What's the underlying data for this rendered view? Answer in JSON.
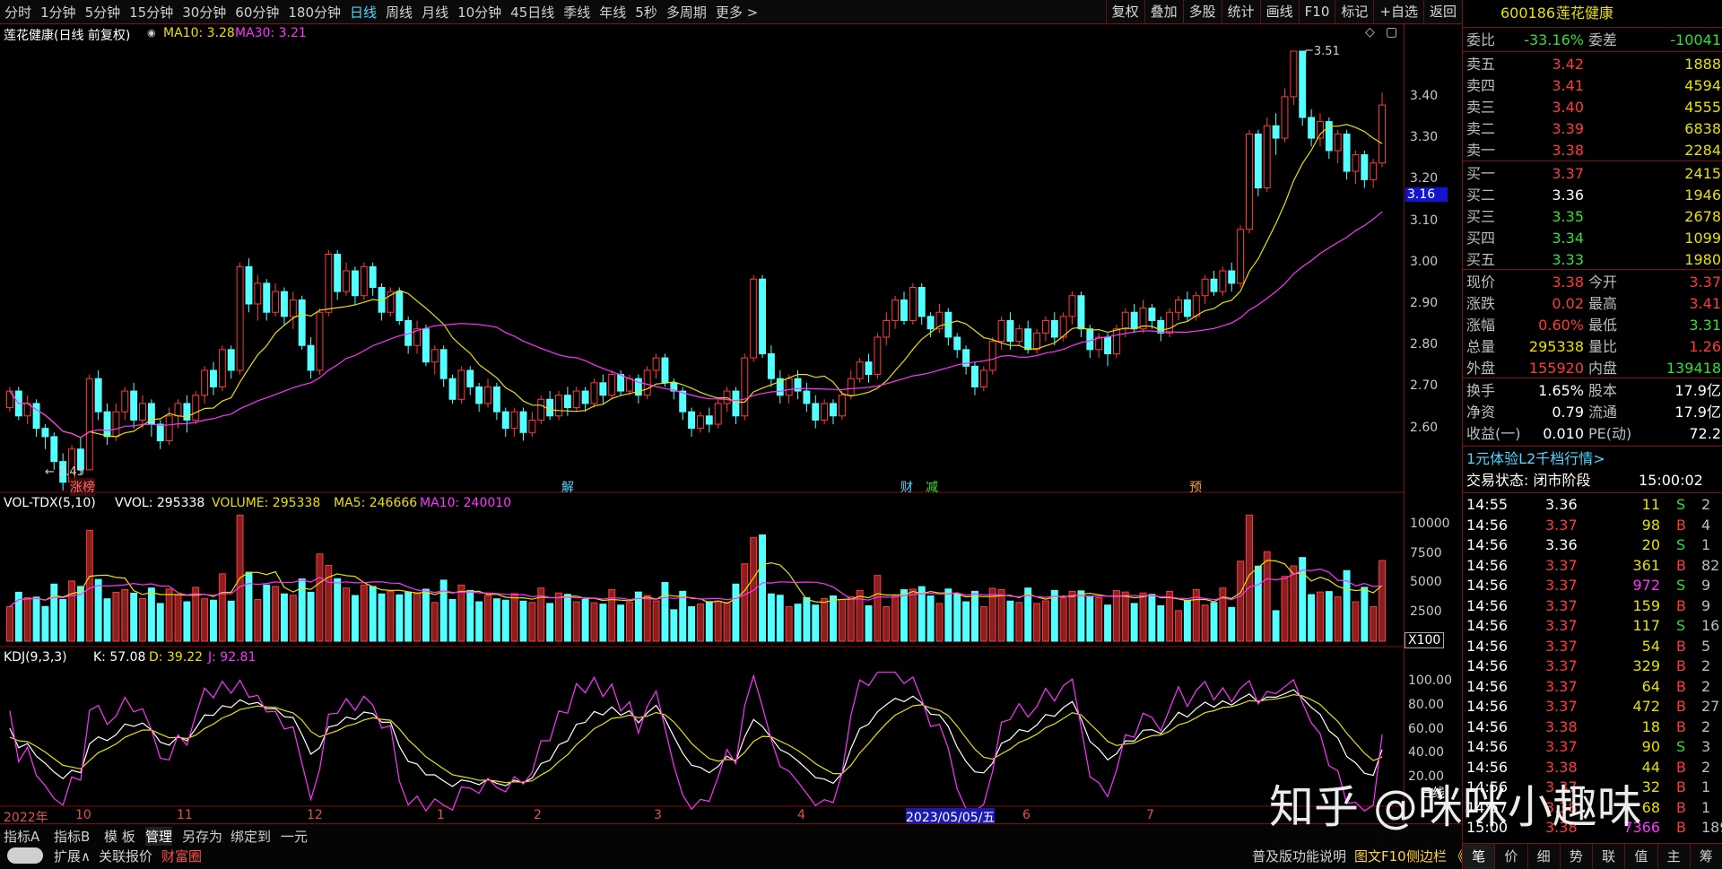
{
  "timeframes": [
    "分时",
    "1分钟",
    "5分钟",
    "15分钟",
    "30分钟",
    "60分钟",
    "180分钟",
    "日线",
    "周线",
    "月线",
    "10分钟",
    "45日线",
    "季线",
    "年线",
    "5秒",
    "多周期",
    "更多 >"
  ],
  "active_timeframe": "日线",
  "toolbar": [
    "复权",
    "叠加",
    "多股",
    "统计",
    "画线",
    "F10",
    "标记",
    "+自选",
    "返回"
  ],
  "chart_title": "莲花健康(日线 前复权)",
  "ma_legend": {
    "ma10": "MA10: 3.28",
    "ma30": "MA30: 3.21"
  },
  "vol_legend": {
    "name": "VOL-TDX(5,10)",
    "vvol": "VVOL: 295338",
    "volume": "VOLUME: 295338",
    "ma5": "MA5: 246666",
    "ma10": "MA10: 240010"
  },
  "kdj_legend": {
    "name": "KDJ(9,3,3)",
    "k": "K: 57.08",
    "d": "D: 39.22",
    "j": "J: 92.81"
  },
  "annotations": {
    "high": "3.51",
    "low": "2.45",
    "current_price_tag": "3.16",
    "x100": "X100"
  },
  "markers": [
    "涨榜",
    "解",
    "财",
    "减",
    "预"
  ],
  "price_axis": [
    "3.40",
    "3.30",
    "3.20",
    "3.10",
    "3.00",
    "2.90",
    "2.80",
    "2.70",
    "2.60"
  ],
  "vol_axis": [
    "10000",
    "7500",
    "5000",
    "2500"
  ],
  "kdj_axis": [
    "100.00",
    "80.00",
    "60.00",
    "40.00",
    "20.00"
  ],
  "date_axis": [
    "2022年",
    "10",
    "11",
    "12",
    "1",
    "2",
    "3",
    "4",
    "2023/05/05/五",
    "6",
    "7",
    "日线"
  ],
  "bottom_tabs": [
    "指标A",
    "指标B",
    "模 板",
    "管理",
    "另存为",
    "绑定到",
    "一元"
  ],
  "bottom_row2": [
    "扩展∧",
    "关联报价",
    "财富圈"
  ],
  "bottom_right": [
    "普及版功能说明",
    "图文F10",
    "侧边栏 《"
  ],
  "stock": {
    "code": "600186",
    "name": "莲花健康"
  },
  "weibi": {
    "label": "委比",
    "value": "-33.16%",
    "wc_label": "委差",
    "wc_value": "-10041"
  },
  "asks": [
    {
      "label": "卖五",
      "price": "3.42",
      "vol": "1888"
    },
    {
      "label": "卖四",
      "price": "3.41",
      "vol": "4594"
    },
    {
      "label": "卖三",
      "price": "3.40",
      "vol": "4555"
    },
    {
      "label": "卖二",
      "price": "3.39",
      "vol": "6838"
    },
    {
      "label": "卖一",
      "price": "3.38",
      "vol": "2284"
    }
  ],
  "bids": [
    {
      "label": "买一",
      "price": "3.37",
      "vol": "2415"
    },
    {
      "label": "买二",
      "price": "3.36",
      "vol": "1946"
    },
    {
      "label": "买三",
      "price": "3.35",
      "vol": "2678"
    },
    {
      "label": "买四",
      "price": "3.34",
      "vol": "1099"
    },
    {
      "label": "买五",
      "price": "3.33",
      "vol": "1980"
    }
  ],
  "quote": [
    {
      "l1": "现价",
      "v1": "3.38",
      "l2": "今开",
      "v2": "3.37"
    },
    {
      "l1": "涨跌",
      "v1": "0.02",
      "l2": "最高",
      "v2": "3.41"
    },
    {
      "l1": "涨幅",
      "v1": "0.60%",
      "l2": "最低",
      "v2": "3.31"
    },
    {
      "l1": "总量",
      "v1": "295338",
      "l2": "量比",
      "v2": "1.26"
    },
    {
      "l1": "外盘",
      "v1": "155920",
      "l2": "内盘",
      "v2": "139418"
    }
  ],
  "stats": [
    {
      "l1": "换手",
      "v1": "1.65%",
      "l2": "股本",
      "v2": "17.9亿"
    },
    {
      "l1": "净资",
      "v1": "0.79",
      "l2": "流通",
      "v2": "17.9亿"
    },
    {
      "l1": "收益(一)",
      "v1": "0.010",
      "l2": "PE(动)",
      "v2": "72.2"
    }
  ],
  "promo": "1元体验L2千档行情>",
  "trade_status": {
    "label": "交易状态: 闭市阶段",
    "time": "15:00:02"
  },
  "ticks": [
    {
      "t": "14:55",
      "p": "3.36",
      "v": "11",
      "s": "S",
      "n": "2"
    },
    {
      "t": "14:56",
      "p": "3.37",
      "v": "98",
      "s": "B",
      "n": "4"
    },
    {
      "t": "14:56",
      "p": "3.36",
      "v": "20",
      "s": "S",
      "n": "1"
    },
    {
      "t": "14:56",
      "p": "3.37",
      "v": "361",
      "s": "B",
      "n": "82"
    },
    {
      "t": "14:56",
      "p": "3.37",
      "v": "972",
      "s": "S",
      "n": "9"
    },
    {
      "t": "14:56",
      "p": "3.37",
      "v": "159",
      "s": "B",
      "n": "9"
    },
    {
      "t": "14:56",
      "p": "3.37",
      "v": "117",
      "s": "S",
      "n": "16"
    },
    {
      "t": "14:56",
      "p": "3.37",
      "v": "54",
      "s": "B",
      "n": "5"
    },
    {
      "t": "14:56",
      "p": "3.37",
      "v": "329",
      "s": "B",
      "n": "2"
    },
    {
      "t": "14:56",
      "p": "3.37",
      "v": "64",
      "s": "B",
      "n": "2"
    },
    {
      "t": "14:56",
      "p": "3.37",
      "v": "472",
      "s": "B",
      "n": "27"
    },
    {
      "t": "14:56",
      "p": "3.38",
      "v": "18",
      "s": "B",
      "n": "2"
    },
    {
      "t": "14:56",
      "p": "3.37",
      "v": "90",
      "s": "S",
      "n": "3"
    },
    {
      "t": "14:56",
      "p": "3.38",
      "v": "44",
      "s": "B",
      "n": "2"
    },
    {
      "t": "14:56",
      "p": "3.37",
      "v": "32",
      "s": "B",
      "n": "1"
    },
    {
      "t": "14:57",
      "p": "3.38",
      "v": "68",
      "s": "B",
      "n": "1"
    },
    {
      "t": "15:00",
      "p": "3.38",
      "v": "7366",
      "s": "B",
      "n": "189"
    }
  ],
  "right_tabs": [
    "笔",
    "价",
    "细",
    "势",
    "联",
    "值",
    "主",
    "筹"
  ],
  "watermark": "知乎 @咪咪小趣味",
  "chart_data": {
    "type": "candlestick",
    "price_range": [
      2.45,
      3.51
    ],
    "candles": [
      [
        2.65,
        2.69,
        2.64,
        2.7
      ],
      [
        2.69,
        2.63,
        2.62,
        2.7
      ],
      [
        2.63,
        2.66,
        2.61,
        2.68
      ],
      [
        2.66,
        2.6,
        2.58,
        2.67
      ],
      [
        2.6,
        2.58,
        2.55,
        2.61
      ],
      [
        2.58,
        2.52,
        2.5,
        2.59
      ],
      [
        2.52,
        2.47,
        2.45,
        2.54
      ],
      [
        2.47,
        2.55,
        2.46,
        2.56
      ],
      [
        2.55,
        2.5,
        2.49,
        2.58
      ],
      [
        2.5,
        2.72,
        2.5,
        2.73
      ],
      [
        2.72,
        2.64,
        2.62,
        2.74
      ],
      [
        2.64,
        2.58,
        2.56,
        2.66
      ],
      [
        2.58,
        2.64,
        2.57,
        2.66
      ],
      [
        2.64,
        2.69,
        2.62,
        2.7
      ],
      [
        2.69,
        2.62,
        2.6,
        2.71
      ],
      [
        2.62,
        2.66,
        2.6,
        2.68
      ],
      [
        2.66,
        2.61,
        2.58,
        2.67
      ],
      [
        2.61,
        2.57,
        2.55,
        2.62
      ],
      [
        2.57,
        2.63,
        2.56,
        2.65
      ],
      [
        2.63,
        2.66,
        2.6,
        2.67
      ],
      [
        2.66,
        2.62,
        2.59,
        2.68
      ],
      [
        2.62,
        2.68,
        2.61,
        2.69
      ],
      [
        2.68,
        2.74,
        2.66,
        2.75
      ],
      [
        2.74,
        2.7,
        2.68,
        2.76
      ],
      [
        2.7,
        2.79,
        2.69,
        2.8
      ],
      [
        2.79,
        2.74,
        2.72,
        2.8
      ],
      [
        2.74,
        2.99,
        2.73,
        3.0
      ],
      [
        2.99,
        2.9,
        2.88,
        3.01
      ],
      [
        2.9,
        2.95,
        2.86,
        2.97
      ],
      [
        2.95,
        2.88,
        2.86,
        2.96
      ],
      [
        2.88,
        2.93,
        2.87,
        2.95
      ],
      [
        2.93,
        2.87,
        2.85,
        2.94
      ],
      [
        2.87,
        2.91,
        2.84,
        2.93
      ],
      [
        2.91,
        2.8,
        2.79,
        2.92
      ],
      [
        2.8,
        2.74,
        2.72,
        2.82
      ],
      [
        2.74,
        2.88,
        2.73,
        2.89
      ],
      [
        2.88,
        3.02,
        2.87,
        3.03
      ],
      [
        3.02,
        2.93,
        2.91,
        3.03
      ],
      [
        2.93,
        2.98,
        2.92,
        3.0
      ],
      [
        2.98,
        2.92,
        2.9,
        2.99
      ],
      [
        2.92,
        2.99,
        2.91,
        3.0
      ],
      [
        2.99,
        2.94,
        2.92,
        3.0
      ],
      [
        2.94,
        2.88,
        2.86,
        2.95
      ],
      [
        2.88,
        2.93,
        2.87,
        2.94
      ],
      [
        2.93,
        2.86,
        2.85,
        2.94
      ],
      [
        2.86,
        2.8,
        2.78,
        2.87
      ],
      [
        2.8,
        2.84,
        2.78,
        2.86
      ],
      [
        2.84,
        2.76,
        2.75,
        2.85
      ],
      [
        2.76,
        2.79,
        2.73,
        2.8
      ],
      [
        2.79,
        2.72,
        2.7,
        2.8
      ],
      [
        2.72,
        2.67,
        2.66,
        2.73
      ],
      [
        2.67,
        2.74,
        2.66,
        2.75
      ],
      [
        2.74,
        2.7,
        2.68,
        2.75
      ],
      [
        2.7,
        2.66,
        2.64,
        2.71
      ],
      [
        2.66,
        2.7,
        2.65,
        2.72
      ],
      [
        2.7,
        2.64,
        2.62,
        2.71
      ],
      [
        2.64,
        2.6,
        2.58,
        2.65
      ],
      [
        2.6,
        2.64,
        2.58,
        2.65
      ],
      [
        2.64,
        2.59,
        2.57,
        2.65
      ],
      [
        2.59,
        2.62,
        2.58,
        2.64
      ],
      [
        2.62,
        2.67,
        2.61,
        2.68
      ],
      [
        2.67,
        2.63,
        2.62,
        2.69
      ],
      [
        2.63,
        2.68,
        2.62,
        2.69
      ],
      [
        2.68,
        2.65,
        2.63,
        2.7
      ],
      [
        2.65,
        2.69,
        2.64,
        2.7
      ],
      [
        2.69,
        2.66,
        2.64,
        2.7
      ],
      [
        2.66,
        2.71,
        2.65,
        2.72
      ],
      [
        2.71,
        2.68,
        2.66,
        2.73
      ],
      [
        2.68,
        2.73,
        2.67,
        2.74
      ],
      [
        2.73,
        2.69,
        2.68,
        2.74
      ],
      [
        2.69,
        2.72,
        2.68,
        2.73
      ],
      [
        2.72,
        2.68,
        2.66,
        2.73
      ],
      [
        2.68,
        2.74,
        2.67,
        2.75
      ],
      [
        2.74,
        2.77,
        2.72,
        2.78
      ],
      [
        2.77,
        2.71,
        2.7,
        2.78
      ],
      [
        2.71,
        2.69,
        2.67,
        2.72
      ],
      [
        2.69,
        2.64,
        2.62,
        2.7
      ],
      [
        2.64,
        2.6,
        2.58,
        2.65
      ],
      [
        2.6,
        2.63,
        2.59,
        2.64
      ],
      [
        2.63,
        2.61,
        2.59,
        2.65
      ],
      [
        2.61,
        2.66,
        2.6,
        2.67
      ],
      [
        2.66,
        2.69,
        2.64,
        2.7
      ],
      [
        2.69,
        2.63,
        2.61,
        2.7
      ],
      [
        2.63,
        2.77,
        2.62,
        2.78
      ],
      [
        2.77,
        2.96,
        2.76,
        2.97
      ],
      [
        2.96,
        2.78,
        2.77,
        2.97
      ],
      [
        2.78,
        2.72,
        2.7,
        2.8
      ],
      [
        2.72,
        2.68,
        2.66,
        2.74
      ],
      [
        2.68,
        2.72,
        2.66,
        2.73
      ],
      [
        2.72,
        2.69,
        2.67,
        2.74
      ],
      [
        2.69,
        2.66,
        2.64,
        2.71
      ],
      [
        2.66,
        2.62,
        2.6,
        2.68
      ],
      [
        2.62,
        2.66,
        2.61,
        2.67
      ],
      [
        2.66,
        2.63,
        2.61,
        2.67
      ],
      [
        2.63,
        2.68,
        2.62,
        2.69
      ],
      [
        2.68,
        2.72,
        2.67,
        2.74
      ],
      [
        2.72,
        2.76,
        2.71,
        2.77
      ],
      [
        2.76,
        2.73,
        2.71,
        2.78
      ],
      [
        2.73,
        2.82,
        2.72,
        2.83
      ],
      [
        2.82,
        2.86,
        2.8,
        2.88
      ],
      [
        2.86,
        2.91,
        2.84,
        2.92
      ],
      [
        2.91,
        2.86,
        2.85,
        2.93
      ],
      [
        2.86,
        2.94,
        2.85,
        2.95
      ],
      [
        2.94,
        2.87,
        2.85,
        2.95
      ],
      [
        2.87,
        2.84,
        2.82,
        2.88
      ],
      [
        2.84,
        2.88,
        2.83,
        2.9
      ],
      [
        2.88,
        2.82,
        2.8,
        2.89
      ],
      [
        2.82,
        2.79,
        2.77,
        2.83
      ],
      [
        2.79,
        2.75,
        2.73,
        2.8
      ],
      [
        2.75,
        2.7,
        2.68,
        2.76
      ],
      [
        2.7,
        2.74,
        2.69,
        2.75
      ],
      [
        2.74,
        2.81,
        2.73,
        2.82
      ],
      [
        2.81,
        2.86,
        2.79,
        2.87
      ],
      [
        2.86,
        2.81,
        2.79,
        2.88
      ],
      [
        2.81,
        2.84,
        2.8,
        2.85
      ],
      [
        2.84,
        2.79,
        2.78,
        2.86
      ],
      [
        2.79,
        2.83,
        2.78,
        2.84
      ],
      [
        2.83,
        2.86,
        2.81,
        2.87
      ],
      [
        2.86,
        2.82,
        2.8,
        2.88
      ],
      [
        2.82,
        2.87,
        2.81,
        2.88
      ],
      [
        2.87,
        2.92,
        2.85,
        2.93
      ],
      [
        2.92,
        2.84,
        2.82,
        2.93
      ],
      [
        2.84,
        2.79,
        2.77,
        2.85
      ],
      [
        2.79,
        2.82,
        2.77,
        2.83
      ],
      [
        2.82,
        2.78,
        2.75,
        2.83
      ],
      [
        2.78,
        2.84,
        2.77,
        2.85
      ],
      [
        2.84,
        2.88,
        2.82,
        2.89
      ],
      [
        2.88,
        2.84,
        2.83,
        2.9
      ],
      [
        2.84,
        2.89,
        2.83,
        2.91
      ],
      [
        2.89,
        2.86,
        2.84,
        2.9
      ],
      [
        2.86,
        2.83,
        2.81,
        2.87
      ],
      [
        2.83,
        2.88,
        2.82,
        2.89
      ],
      [
        2.88,
        2.91,
        2.86,
        2.92
      ],
      [
        2.91,
        2.87,
        2.86,
        2.93
      ],
      [
        2.87,
        2.92,
        2.86,
        2.93
      ],
      [
        2.92,
        2.96,
        2.9,
        2.97
      ],
      [
        2.96,
        2.93,
        2.92,
        2.98
      ],
      [
        2.93,
        2.98,
        2.92,
        2.99
      ],
      [
        2.98,
        2.95,
        2.93,
        3.0
      ],
      [
        2.95,
        3.08,
        2.94,
        3.09
      ],
      [
        3.08,
        3.31,
        3.07,
        3.32
      ],
      [
        3.31,
        3.18,
        3.16,
        3.32
      ],
      [
        3.18,
        3.33,
        3.17,
        3.35
      ],
      [
        3.33,
        3.3,
        3.26,
        3.36
      ],
      [
        3.3,
        3.4,
        3.29,
        3.42
      ],
      [
        3.4,
        3.51,
        3.38,
        3.51
      ],
      [
        3.51,
        3.35,
        3.33,
        3.51
      ],
      [
        3.35,
        3.3,
        3.28,
        3.37
      ],
      [
        3.3,
        3.34,
        3.28,
        3.36
      ],
      [
        3.34,
        3.27,
        3.25,
        3.35
      ],
      [
        3.27,
        3.31,
        3.24,
        3.32
      ],
      [
        3.31,
        3.22,
        3.2,
        3.32
      ],
      [
        3.22,
        3.26,
        3.19,
        3.27
      ],
      [
        3.26,
        3.2,
        3.18,
        3.27
      ],
      [
        3.2,
        3.24,
        3.18,
        3.25
      ],
      [
        3.24,
        3.38,
        3.23,
        3.41
      ]
    ]
  }
}
